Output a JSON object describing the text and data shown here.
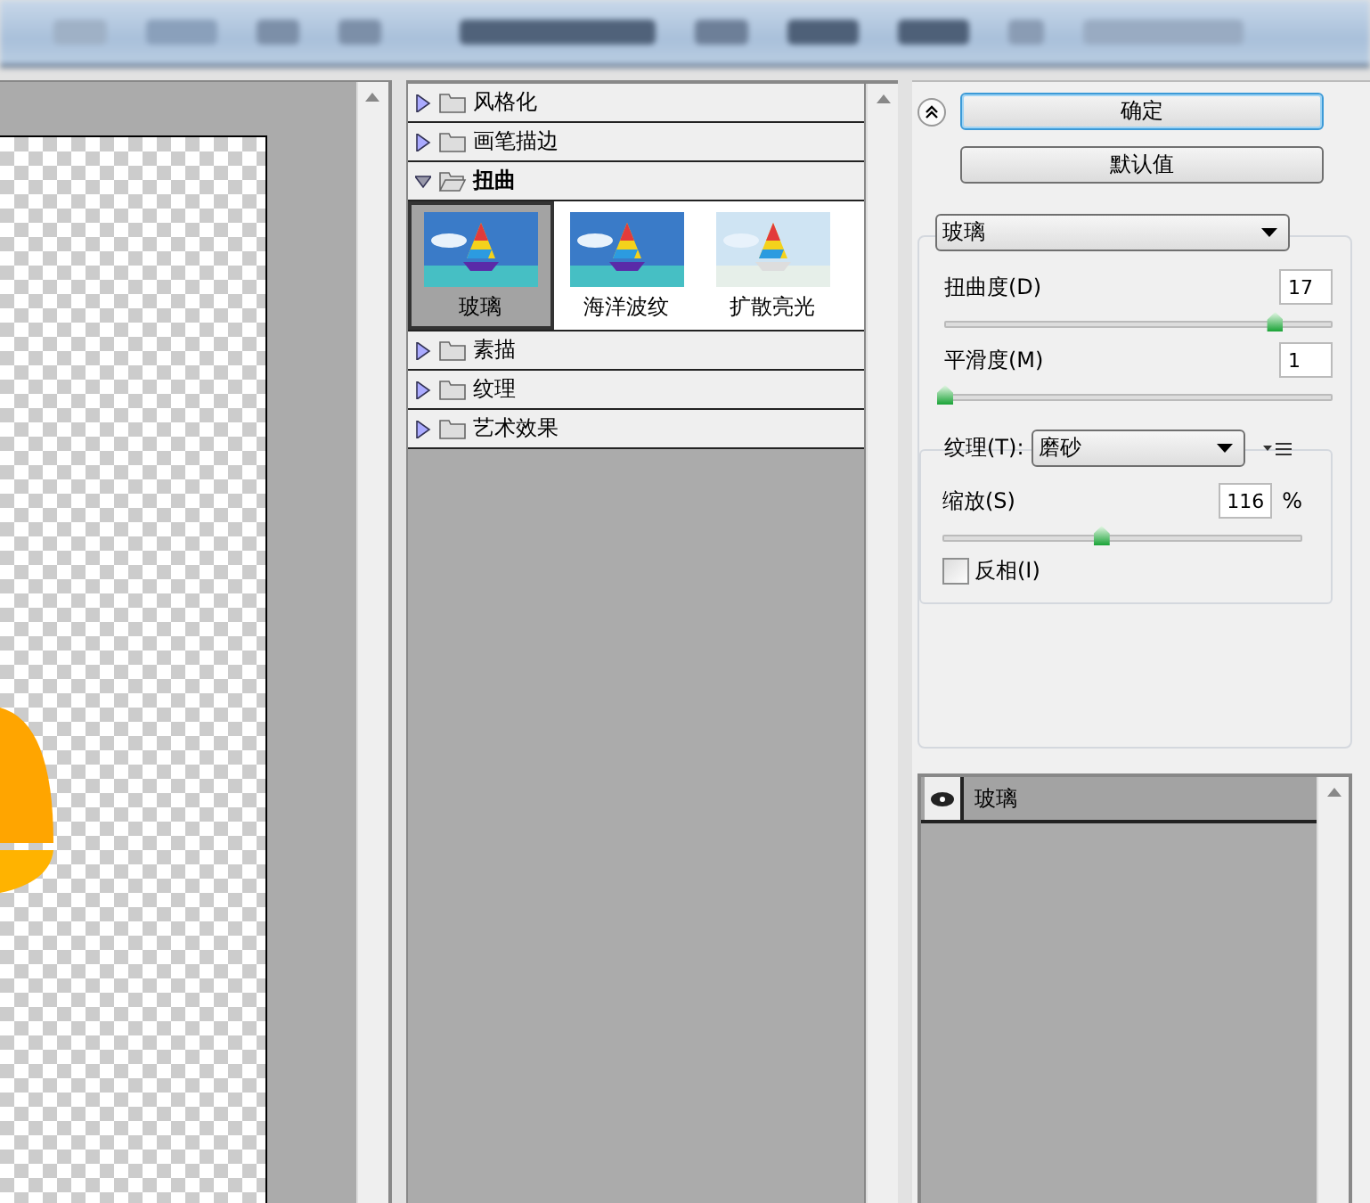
{
  "categories": [
    {
      "label": "风格化",
      "expanded": false
    },
    {
      "label": "画笔描边",
      "expanded": false
    },
    {
      "label": "扭曲",
      "expanded": true,
      "filters": [
        {
          "label": "玻璃",
          "selected": true
        },
        {
          "label": "海洋波纹",
          "selected": false
        },
        {
          "label": "扩散亮光",
          "selected": false
        }
      ]
    },
    {
      "label": "素描",
      "expanded": false
    },
    {
      "label": "纹理",
      "expanded": false
    },
    {
      "label": "艺术效果",
      "expanded": false
    }
  ],
  "buttons": [
    {
      "label": "确定",
      "kind": "default"
    },
    {
      "label": "默认值",
      "kind": "normal"
    }
  ],
  "filter_select": {
    "value": "玻璃"
  },
  "params": [
    {
      "label": "扭曲度(D)",
      "value": "17",
      "level": 0.85
    },
    {
      "label": "平滑度(M)",
      "value": "1",
      "level": 0
    }
  ],
  "texture": {
    "label": "纹理(T):",
    "value": "磨砂"
  },
  "scale": {
    "label": "缩放(S)",
    "value": "116",
    "unit": "%",
    "level": 0.44
  },
  "invert": {
    "label": "反相(I)",
    "checked": false
  },
  "layers": [
    {
      "label": "玻璃",
      "visible": true
    }
  ]
}
